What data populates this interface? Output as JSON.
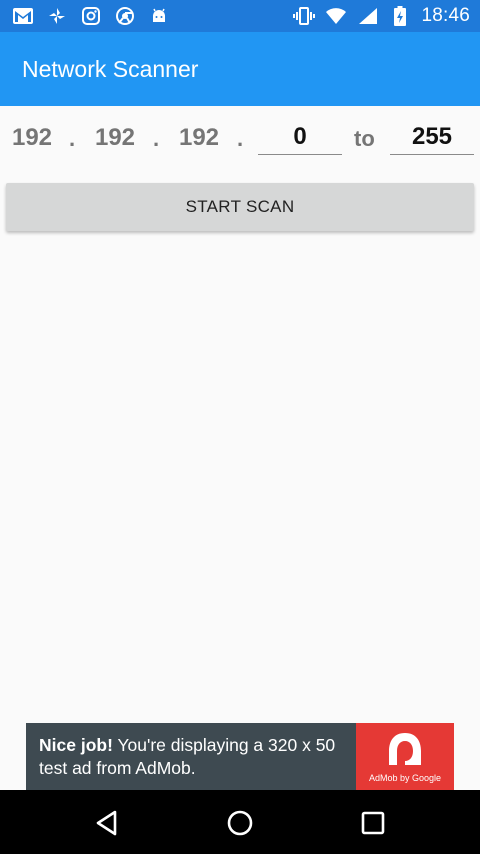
{
  "status_bar": {
    "time": "18:46",
    "left_icons": [
      "gmail-icon",
      "pinwheel-icon",
      "instagram-icon",
      "chrome-icon",
      "android-icon"
    ],
    "right_icons": [
      "vibrate-icon",
      "wifi-icon",
      "signal-icon",
      "battery-icon"
    ]
  },
  "app_bar": {
    "title": "Network Scanner"
  },
  "ip_range": {
    "octet1": "192",
    "octet2": "192",
    "octet3": "192",
    "separator": ".",
    "start_value": "0",
    "to_label": "to",
    "end_value": "255"
  },
  "scan_button": {
    "label": "START SCAN"
  },
  "ad_banner": {
    "headline": "Nice job!",
    "body": " You're displaying a 320 x 50 test ad from AdMob.",
    "brand_caption": "AdMob by Google"
  },
  "nav_bar": {
    "icons": [
      "back-icon",
      "home-icon",
      "recents-icon"
    ]
  },
  "colors": {
    "status_bar": "#1f7ad9",
    "app_bar": "#2196f3",
    "ad_background": "#3e4a51",
    "ad_logo": "#e53935",
    "button": "#d6d7d7"
  }
}
